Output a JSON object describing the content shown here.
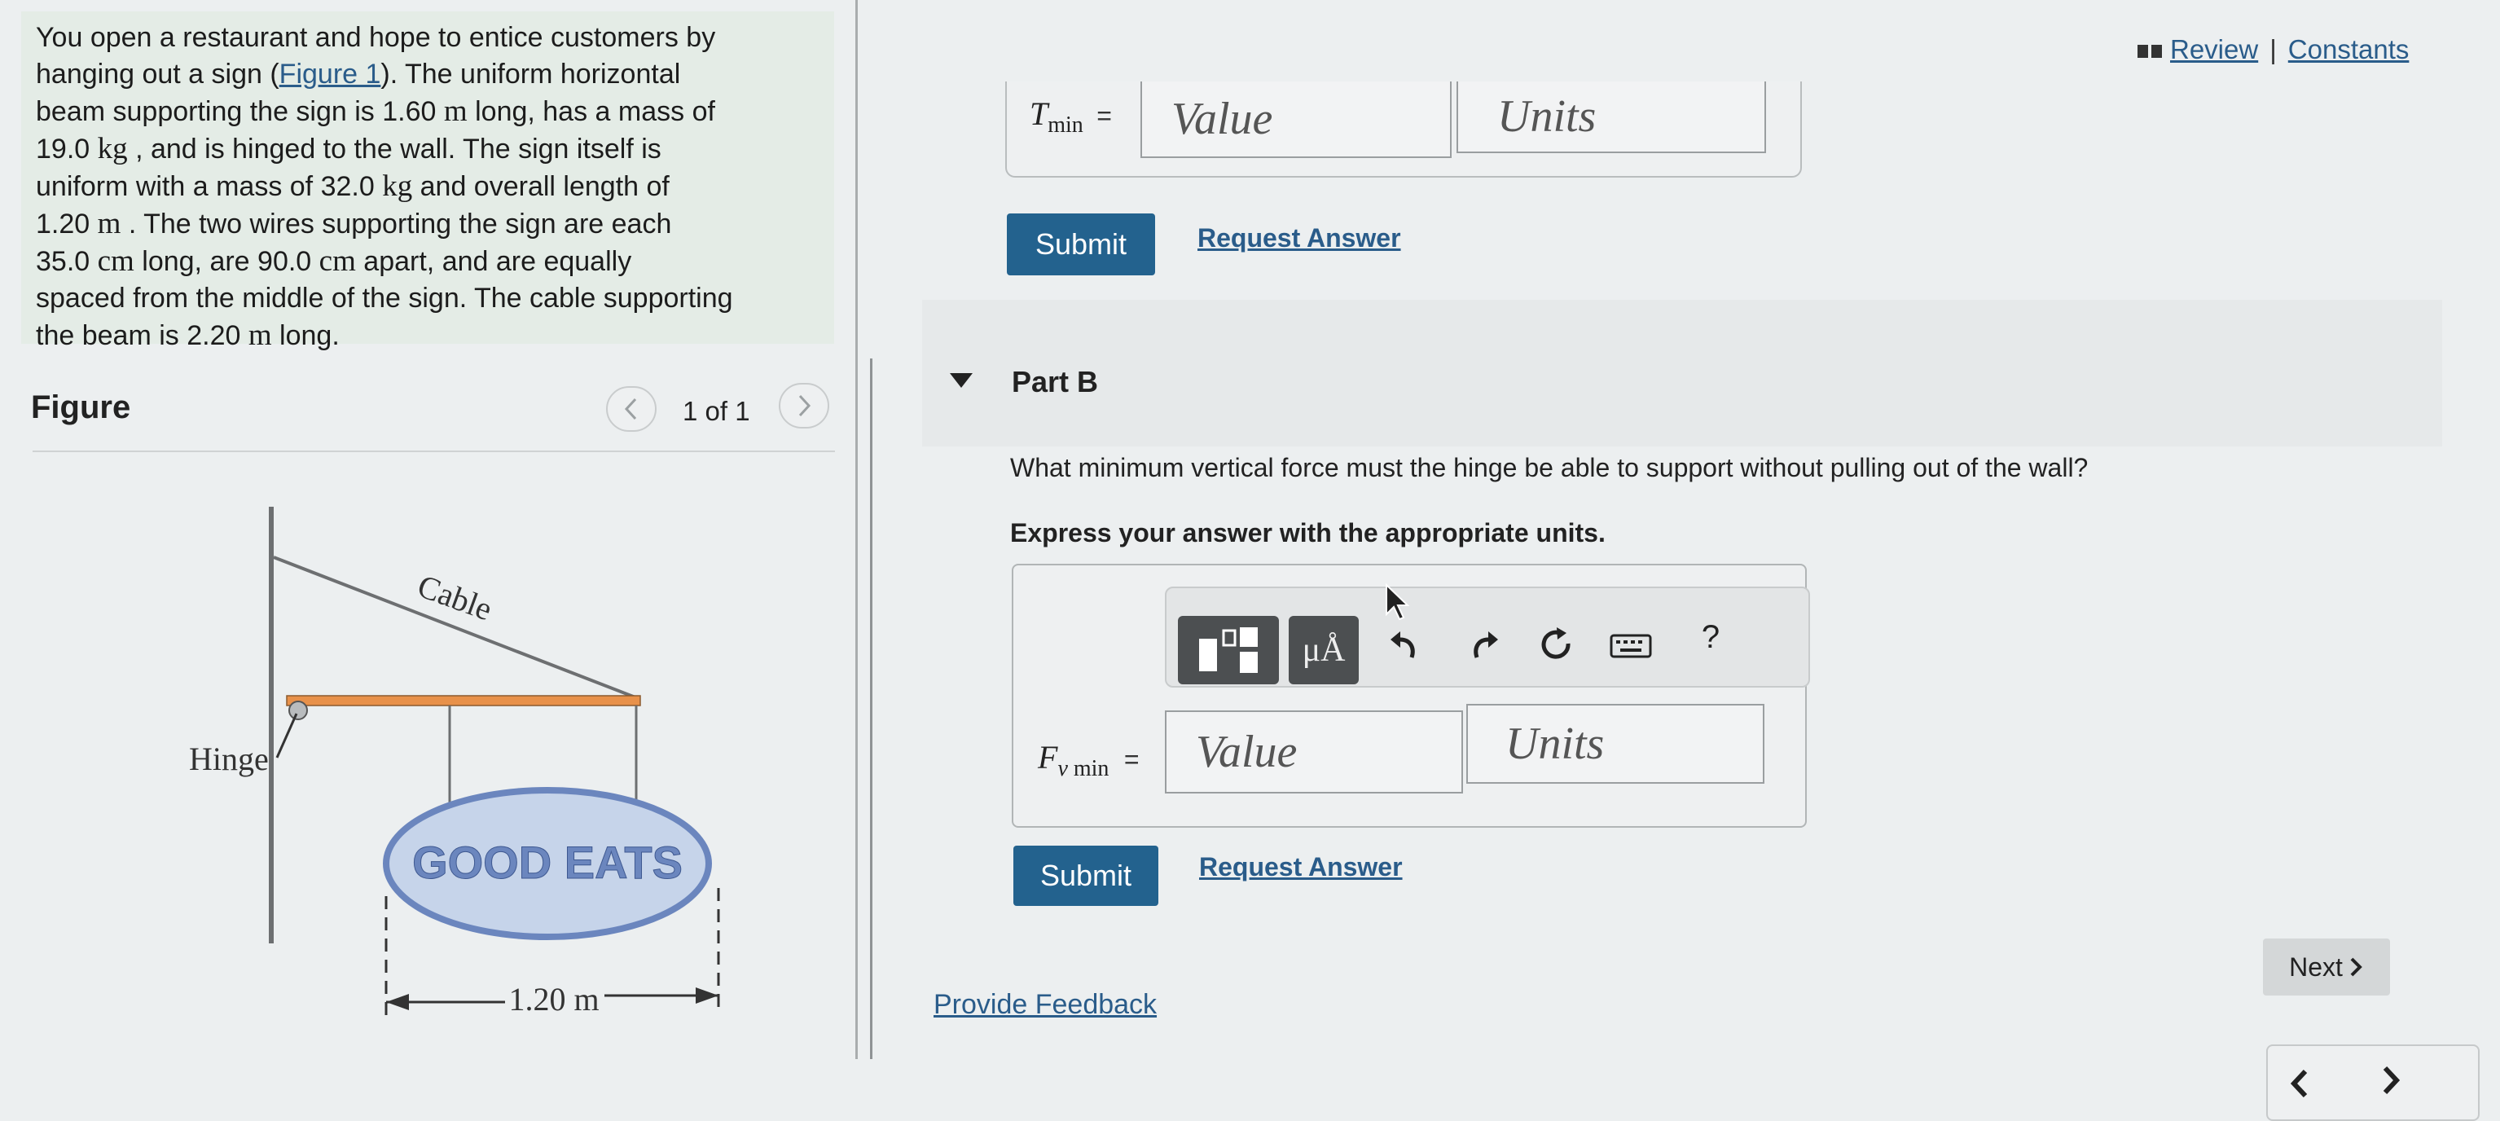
{
  "problem": {
    "lines": [
      "You open a restaurant and hope to entice customers by",
      "hanging out a sign (",
      "Figure 1",
      "). The uniform horizontal",
      "beam supporting the sign is 1.60 ",
      "m",
      " long, has a mass of",
      "19.0 ",
      "kg",
      " , and is hinged to the wall. The sign itself is",
      "uniform with a mass of 32.0 ",
      "kg",
      " and overall length of",
      "1.20 ",
      "m",
      " . The two wires supporting the sign are each",
      "35.0 ",
      "cm",
      " long, are 90.0 ",
      "cm",
      " apart, and are equally",
      "spaced from the middle of the sign. The cable supporting",
      "the beam is 2.20 ",
      "m",
      " long."
    ]
  },
  "figure": {
    "title": "Figure",
    "prev_icon": "chevron-left-icon",
    "next_icon": "chevron-right-icon",
    "count": "1 of 1",
    "labels": {
      "cable": "Cable",
      "hinge": "Hinge",
      "sign_text": "GOOD EATS",
      "dimension": "1.20 m"
    }
  },
  "header_links": {
    "review_icon": "book-icon",
    "review": "Review",
    "separator": "|",
    "constants": "Constants"
  },
  "part_a": {
    "var": "T",
    "sub": "min",
    "equals": "=",
    "value_placeholder": "Value",
    "units_placeholder": "Units",
    "submit": "Submit",
    "request": "Request Answer"
  },
  "part_b": {
    "collapse_icon": "caret-down-icon",
    "title": "Part B",
    "question": "What minimum vertical force must the hinge be able to support without pulling out of the wall?",
    "instruction": "Express your answer with the appropriate units.",
    "toolbar": {
      "template_icon": "template-icon",
      "units_label": "μÅ",
      "undo_icon": "undo-icon",
      "redo_icon": "redo-icon",
      "reset_icon": "reset-icon",
      "keyboard_icon": "keyboard-icon",
      "help": "?"
    },
    "var": "F",
    "var_sub": "v",
    "sub": "min",
    "equals": "=",
    "value_placeholder": "Value",
    "units_placeholder": "Units",
    "submit": "Submit",
    "request": "Request Answer"
  },
  "footer": {
    "feedback": "Provide Feedback",
    "next": "Next",
    "next_icon": "chevron-right-icon",
    "prev_page_icon": "chevron-left-icon",
    "next_page_icon": "chevron-right-icon"
  },
  "colors": {
    "link": "#2a5c8a",
    "submit": "#23628e",
    "problem_bg": "#e4ece6",
    "beam": "#e8914a",
    "sign_fill": "#c6d4ea",
    "sign_border": "#6b86be"
  }
}
